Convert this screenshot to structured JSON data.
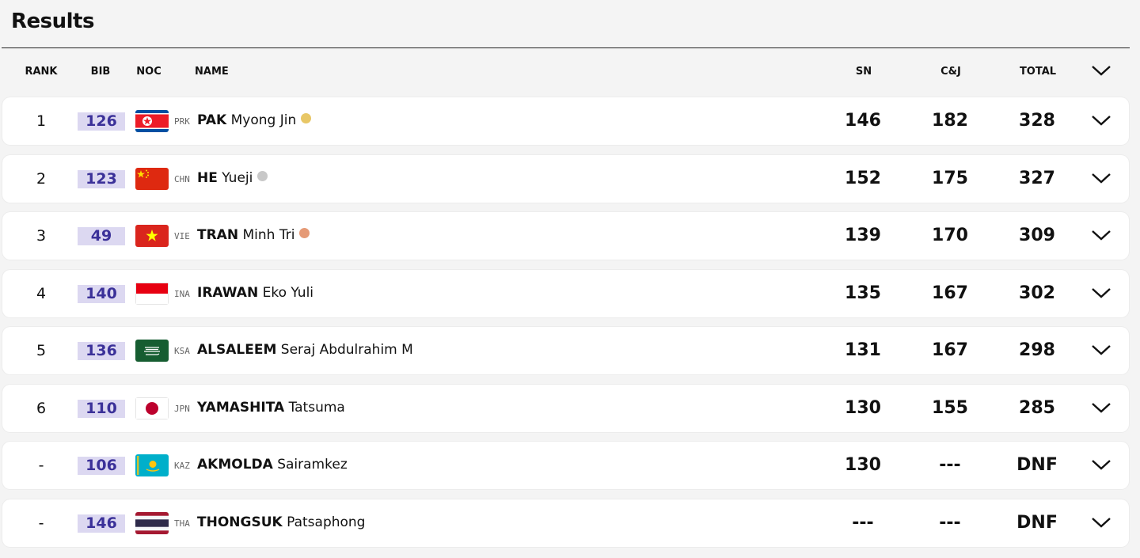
{
  "page_title": "Results",
  "headers": {
    "rank": "RANK",
    "bib": "BIB",
    "noc": "NOC",
    "name": "NAME",
    "sn": "SN",
    "cj": "C&J",
    "total": "TOTAL"
  },
  "colors": {
    "bib_bg": "#dcd8f1",
    "bib_text": "#3b3199",
    "gold": "#e8c766",
    "silver": "#c8c8c8",
    "bronze": "#e59a76"
  },
  "rows": [
    {
      "rank": "1",
      "bib": "126",
      "noc": "PRK",
      "last": "PAK",
      "first": "Myong Jin",
      "medal": "gold",
      "sn": "146",
      "cj": "182",
      "total": "328"
    },
    {
      "rank": "2",
      "bib": "123",
      "noc": "CHN",
      "last": "HE",
      "first": "Yueji",
      "medal": "silver",
      "sn": "152",
      "cj": "175",
      "total": "327"
    },
    {
      "rank": "3",
      "bib": "49",
      "noc": "VIE",
      "last": "TRAN",
      "first": "Minh Tri",
      "medal": "bronze",
      "sn": "139",
      "cj": "170",
      "total": "309"
    },
    {
      "rank": "4",
      "bib": "140",
      "noc": "INA",
      "last": "IRAWAN",
      "first": "Eko Yuli",
      "medal": "",
      "sn": "135",
      "cj": "167",
      "total": "302"
    },
    {
      "rank": "5",
      "bib": "136",
      "noc": "KSA",
      "last": "ALSALEEM",
      "first": "Seraj Abdulrahim M",
      "medal": "",
      "sn": "131",
      "cj": "167",
      "total": "298"
    },
    {
      "rank": "6",
      "bib": "110",
      "noc": "JPN",
      "last": "YAMASHITA",
      "first": "Tatsuma",
      "medal": "",
      "sn": "130",
      "cj": "155",
      "total": "285"
    },
    {
      "rank": "-",
      "bib": "106",
      "noc": "KAZ",
      "last": "AKMOLDA",
      "first": "Sairamkez",
      "medal": "",
      "sn": "130",
      "cj": "---",
      "total": "DNF"
    },
    {
      "rank": "-",
      "bib": "146",
      "noc": "THA",
      "last": "THONGSUK",
      "first": "Patsaphong",
      "medal": "",
      "sn": "---",
      "cj": "---",
      "total": "DNF"
    }
  ],
  "icons": {
    "expand": "chevron-down-icon",
    "medal": "medal-dot-icon"
  }
}
